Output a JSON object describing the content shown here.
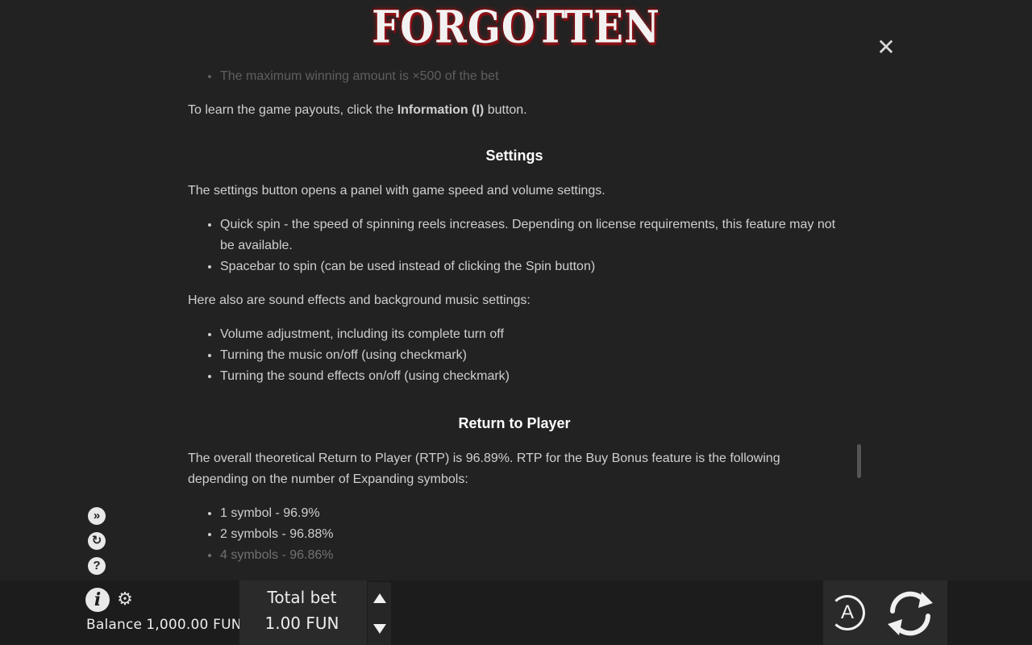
{
  "header": {
    "logo_text": "FORGOTTEN",
    "close_icon": "close-icon"
  },
  "content": {
    "faded_line": "The maximum winning amount is ×500 of the bet",
    "payouts_prefix": "To learn the game payouts, click the ",
    "payouts_bold": "Information (I)",
    "payouts_suffix": " button.",
    "settings_heading": "Settings",
    "settings_intro": "The settings button opens a panel with game speed and volume settings.",
    "settings_items": [
      "Quick spin - the speed of spinning reels increases. Depending on license requirements, this feature may not be available.",
      "Spacebar to spin (can be used instead of clicking the Spin button)"
    ],
    "sound_intro": "Here also are sound effects and background music settings:",
    "sound_items": [
      "Volume adjustment, including its complete turn off",
      "Turning the music on/off (using checkmark)",
      "Turning the sound effects on/off (using checkmark)"
    ],
    "rtp_heading": "Return to Player",
    "rtp_text": "The overall theoretical Return to Player (RTP) is 96.89%. RTP for the Buy Bonus feature is the following depending on the number of Expanding symbols:",
    "rtp_items": [
      "1 symbol - 96.9%",
      "2 symbols - 96.88%",
      "4 symbols - 96.86%"
    ]
  },
  "side_icons": [
    "turbo-icon",
    "autoplay-icon",
    "help-icon"
  ],
  "footer": {
    "info_icon": "i",
    "gear_icon": "gear-icon",
    "balance_label": "Balance",
    "balance_value": "1,000.00 FUN",
    "total_bet_label": "Total bet",
    "total_bet_value": "1.00 FUN",
    "auto_label": "A",
    "spin_icon": "spin-icon"
  },
  "colors": {
    "background": "#222222",
    "bar": "#1c1c1c",
    "accent_red": "#b0181e"
  }
}
